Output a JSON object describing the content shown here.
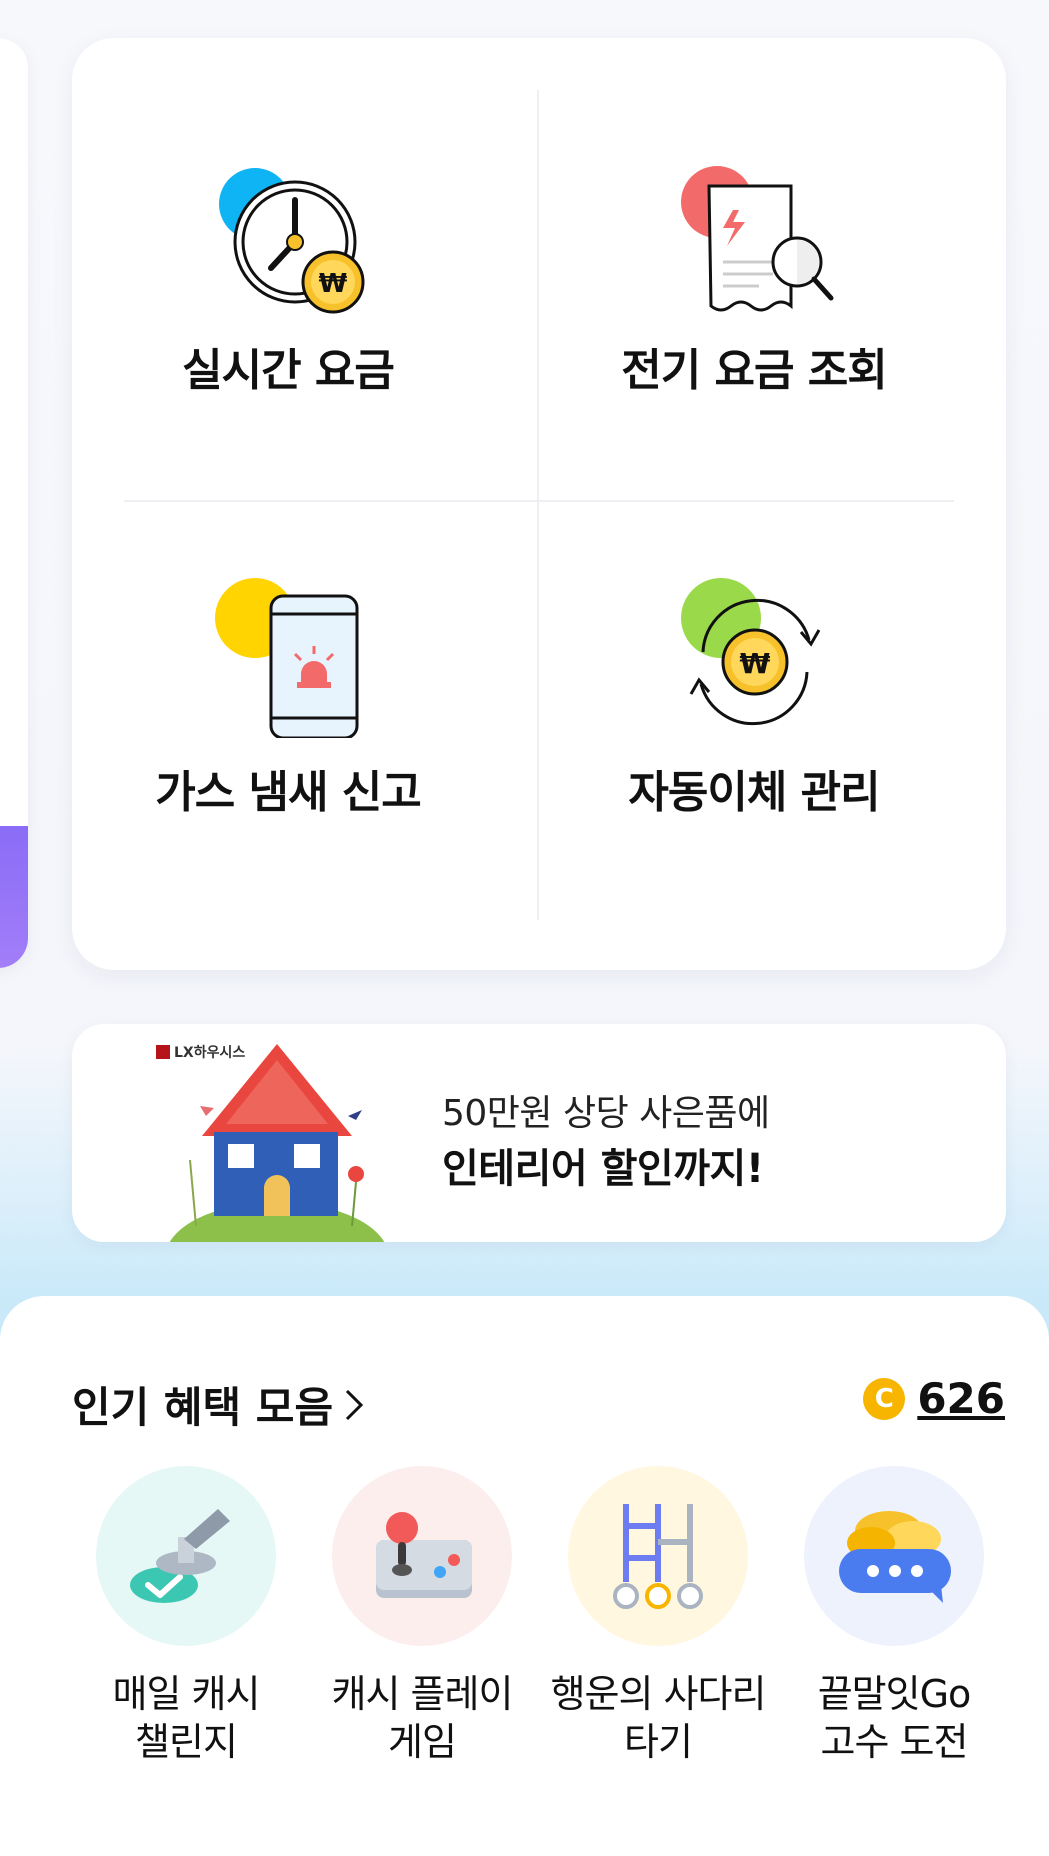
{
  "menu": {
    "tiles": [
      {
        "label": "실시간 요금",
        "icon": "clock-won-icon",
        "accent": "#0fb4f5"
      },
      {
        "label": "전기 요금 조회",
        "icon": "bill-search-icon",
        "accent": "#f36a6a"
      },
      {
        "label": "가스 냄새 신고",
        "icon": "phone-siren-icon",
        "accent": "#ffd400"
      },
      {
        "label": "자동이체 관리",
        "icon": "auto-transfer-icon",
        "accent": "#9ad94a"
      }
    ]
  },
  "banner": {
    "brand": "LX하우시스",
    "line1": "50만원 상당 사은품에",
    "line2": "인테리어 할인까지!"
  },
  "benefits": {
    "title": "인기 혜택 모음",
    "points_icon": "C",
    "points": "626",
    "items": [
      {
        "label_line1": "매일 캐시",
        "label_line2": "챌린지",
        "icon": "stamp-icon",
        "bg": "#e6f8f5"
      },
      {
        "label_line1": "캐시 플레이",
        "label_line2": "게임",
        "icon": "game-controller-icon",
        "bg": "#fdeeee"
      },
      {
        "label_line1": "행운의 사다리",
        "label_line2": "타기",
        "icon": "ladder-icon",
        "bg": "#fff7df"
      },
      {
        "label_line1": "끝말잇Go",
        "label_line2": "고수 도전",
        "icon": "chat-coins-icon",
        "bg": "#eef2fc"
      }
    ]
  }
}
